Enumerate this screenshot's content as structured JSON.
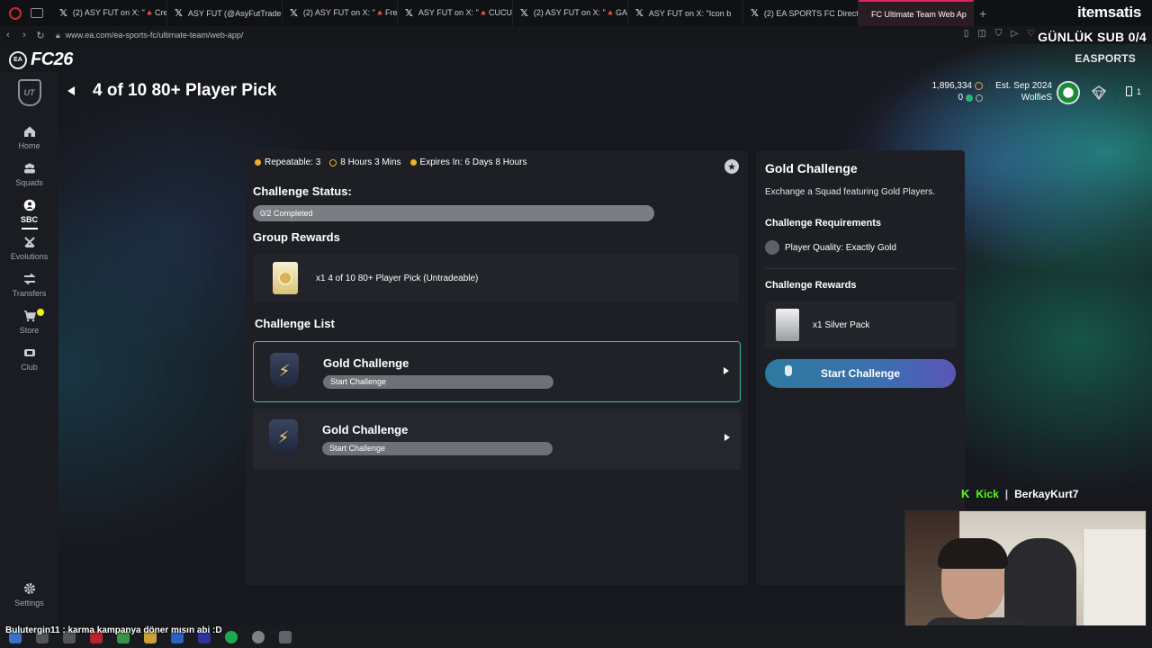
{
  "browser": {
    "tabs": [
      {
        "label": "(2) ASY FUT on X: \"🔺Cre"
      },
      {
        "label": "ASY FUT (@AsyFutTrade"
      },
      {
        "label": "(2) ASY FUT on X: \"🔺Fre"
      },
      {
        "label": "ASY FUT on X: \"🔺CUCU"
      },
      {
        "label": "(2) ASY FUT on X: \"🔺GA"
      },
      {
        "label": "ASY FUT on X: \"Icon b"
      },
      {
        "label": "(2) EA SPORTS FC Direct"
      },
      {
        "label": "FC Ultimate Team Web Ap"
      }
    ],
    "url": "www.ea.com/ea-sports-fc/ultimate-team/web-app/",
    "brand": "itemsatis",
    "stream_overlay": "GÜNLÜK SUB 0/4"
  },
  "app": {
    "logo_ea": "EA",
    "logo_fc": "FC26",
    "ea_sports": "EASPORTS",
    "ut_badge": "UT",
    "page_title": "4 of 10 80+ Player Pick",
    "coins": "1,896,334",
    "points": "0",
    "est": "Est. Sep 2024",
    "club_name": "WolfieS",
    "notifications": "1"
  },
  "sidebar": {
    "items": [
      {
        "label": "Home",
        "icon": "home-icon"
      },
      {
        "label": "Squads",
        "icon": "squads-icon"
      },
      {
        "label": "SBC",
        "icon": "sbc-icon"
      },
      {
        "label": "Evolutions",
        "icon": "evolutions-icon"
      },
      {
        "label": "Transfers",
        "icon": "transfers-icon"
      },
      {
        "label": "Store",
        "icon": "store-icon"
      },
      {
        "label": "Club",
        "icon": "club-icon"
      }
    ],
    "settings": "Settings"
  },
  "main": {
    "repeatable": "Repeatable: 3",
    "refresh": "8 Hours 3 Mins",
    "expires": "Expires In: 6 Days 8 Hours",
    "status_label": "Challenge Status:",
    "progress_text": "0/2 Completed",
    "progress_value": 0,
    "group_rewards_label": "Group Rewards",
    "group_reward_text": "x1 4 of 10 80+ Player Pick (Untradeable)",
    "challenge_list_label": "Challenge List",
    "challenges": [
      {
        "name": "Gold Challenge",
        "action": "Start Challenge"
      },
      {
        "name": "Gold Challenge",
        "action": "Start Challenge"
      }
    ]
  },
  "side": {
    "title": "Gold Challenge",
    "description": "Exchange a Squad featuring Gold Players.",
    "requirements_label": "Challenge Requirements",
    "requirement": "Player Quality: Exactly Gold",
    "rewards_label": "Challenge Rewards",
    "reward": "x1 Silver Pack",
    "start_button": "Start Challenge"
  },
  "stream": {
    "kick_label": "Kick",
    "separator": "|",
    "channel": "BerkayKurt7",
    "chat_message": "Bulutergin11 : karma kampanya döner mısın abi :D"
  },
  "colors": {
    "accent": "#3fbf9a",
    "start_button": "#3b6fb0",
    "kick": "#53fc18",
    "store_dot": "#e9f51a"
  }
}
